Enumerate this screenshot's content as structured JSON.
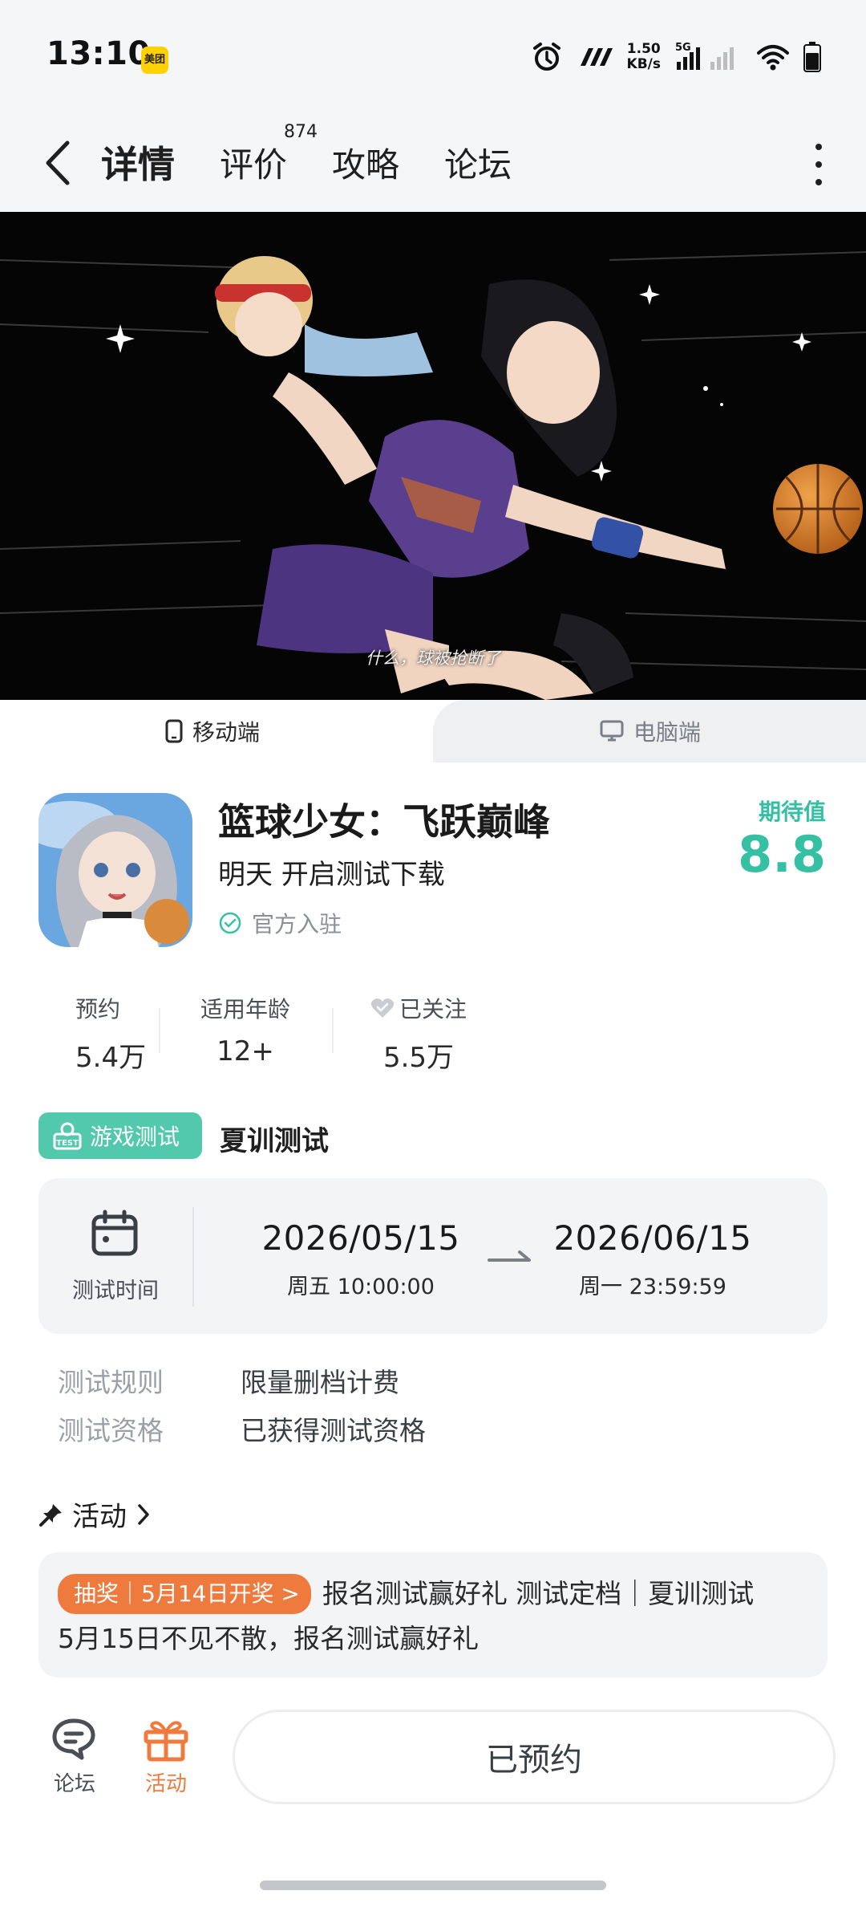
{
  "status_bar": {
    "time": "13:10",
    "app_badge": "美团",
    "net_speed_value": "1.50",
    "net_speed_unit": "KB/s",
    "network_type": "5G",
    "icons": [
      "alarm-icon",
      "nfc-icon",
      "signal-icon",
      "wifi-icon",
      "battery-icon"
    ]
  },
  "nav": {
    "tabs": [
      {
        "label": "详情",
        "active": true
      },
      {
        "label": "评价",
        "count": "874"
      },
      {
        "label": "攻略"
      },
      {
        "label": "论坛"
      }
    ]
  },
  "hero": {
    "caption": "什么，球被抢断了"
  },
  "platform_tabs": {
    "mobile": "移动端",
    "pc": "电脑端",
    "selected": "mobile"
  },
  "app": {
    "title": "篮球少女：飞跃巅峰",
    "subtitle": "明天 开启测试下载",
    "official": "官方入驻",
    "expect_label": "期待值",
    "expect_value": "8.8"
  },
  "stats": [
    {
      "label": "预约",
      "value": "5.4万"
    },
    {
      "label": "适用年龄",
      "value": "12+"
    },
    {
      "label": "已关注",
      "value": "5.5万"
    }
  ],
  "test": {
    "badge": "游戏测试",
    "badge_icon_text": "TEST",
    "name": "夏训测试",
    "time_label": "测试时间",
    "start_date": "2026/05/15",
    "start_time": "周五  10:00:00",
    "end_date": "2026/06/15",
    "end_time": "周一  23:59:59",
    "rules": [
      {
        "key": "测试规则",
        "value": "限量删档计费"
      },
      {
        "key": "测试资格",
        "value": "已获得测试资格"
      }
    ]
  },
  "activity": {
    "header": "活动",
    "tag": "抽奖｜5月14日开奖 >",
    "line1": "报名测试赢好礼 测试定档｜夏训测试",
    "line2": "5月15日不见不散，报名测试赢好礼"
  },
  "bottom": {
    "forum_label": "论坛",
    "activity_label": "活动",
    "reserve_label": "已预约"
  },
  "colors": {
    "accent": "#35c0a4",
    "orange": "#ef7a3e"
  }
}
